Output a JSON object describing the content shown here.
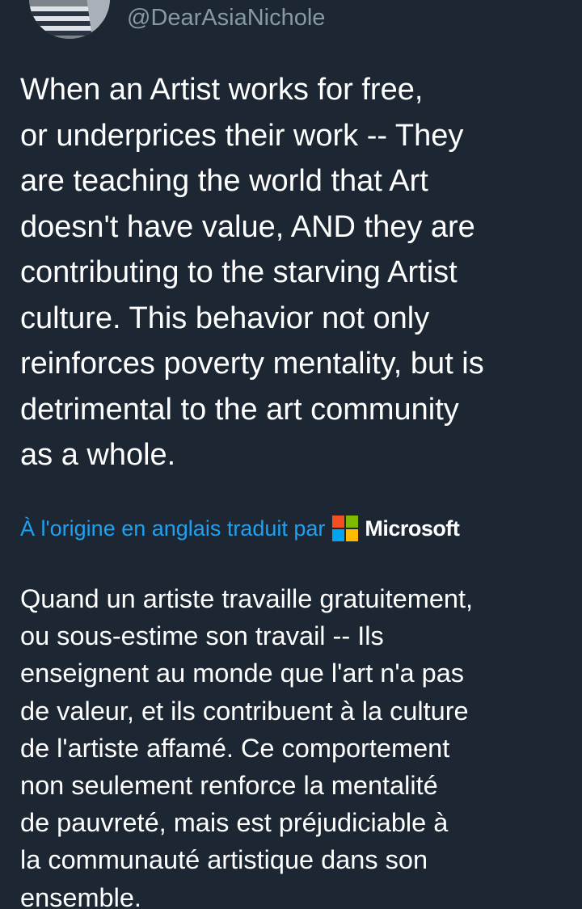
{
  "tweet": {
    "handle": "@DearAsiaNichole",
    "text_lines": [
      "When an Artist works for free,",
      "or underprices their work -- They",
      "are teaching the world that Art",
      "doesn't have value, AND they are",
      "contributing to the starving Artist",
      "culture. This behavior not only",
      "reinforces poverty mentality, but is",
      "detrimental to the art community",
      "as a whole."
    ]
  },
  "translation": {
    "translated_by_label": "À l'origine en anglais traduit par",
    "provider_name": "Microsoft",
    "provider_icon": "microsoft-logo-icon",
    "text_lines": [
      "Quand un artiste travaille gratuitement,",
      "ou sous-estime son travail -- Ils",
      "enseignent au monde que l'art n'a pas",
      "de valeur, et ils contribuent à la culture",
      "de l'artiste affamé. Ce comportement",
      "non seulement renforce la mentalité",
      "de pauvreté, mais est préjudiciable à",
      "la communauté artistique dans son",
      "ensemble."
    ]
  },
  "colors": {
    "background": "#1c2733",
    "text": "#ffffff",
    "secondary_text": "#8899a6",
    "link": "#1da1f2",
    "ms_red": "#f25022",
    "ms_green": "#7fba00",
    "ms_blue": "#00a4ef",
    "ms_yellow": "#ffb900"
  }
}
